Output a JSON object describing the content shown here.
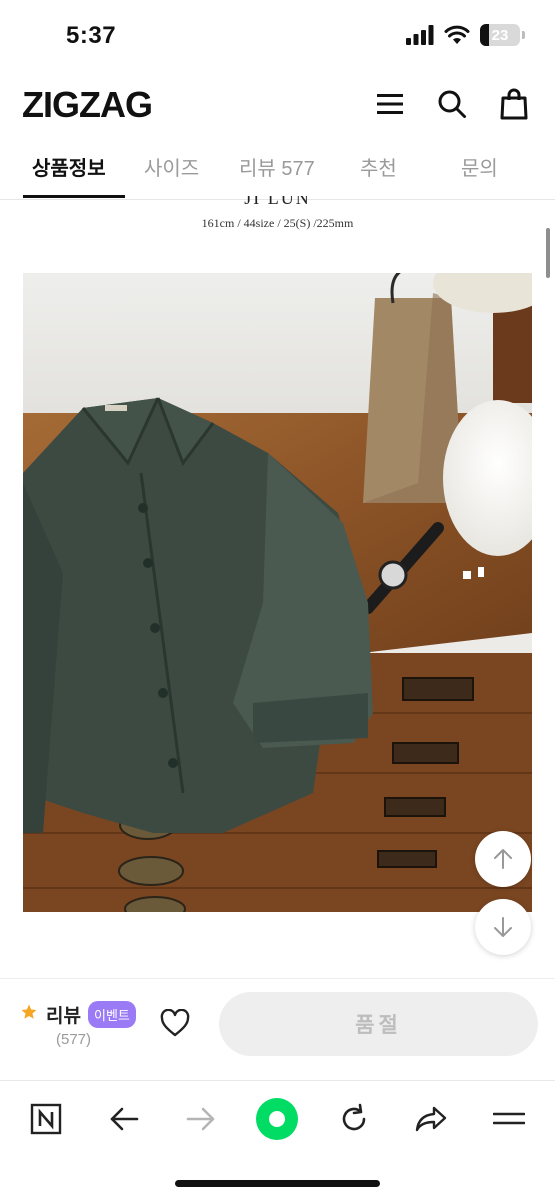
{
  "status_bar": {
    "time": "5:37",
    "battery": "23"
  },
  "app": {
    "logo": "ZIGZAG"
  },
  "tabs": [
    {
      "label": "상품정보",
      "active": true
    },
    {
      "label": "사이즈",
      "active": false
    },
    {
      "label": "리뷰 577",
      "active": false
    },
    {
      "label": "추천",
      "active": false
    },
    {
      "label": "문의",
      "active": false
    }
  ],
  "content": {
    "caption_cut": "JI LUN",
    "size_info": "161cm / 44size / 25(S) /225mm"
  },
  "bottom_bar": {
    "review_label": "리뷰",
    "event_badge": "이벤트",
    "review_count": "(577)",
    "soldout_label": "품절"
  },
  "colors": {
    "accent_purple": "#9b7bf5",
    "star": "#f5a623",
    "browser_green": "#00dc64"
  }
}
